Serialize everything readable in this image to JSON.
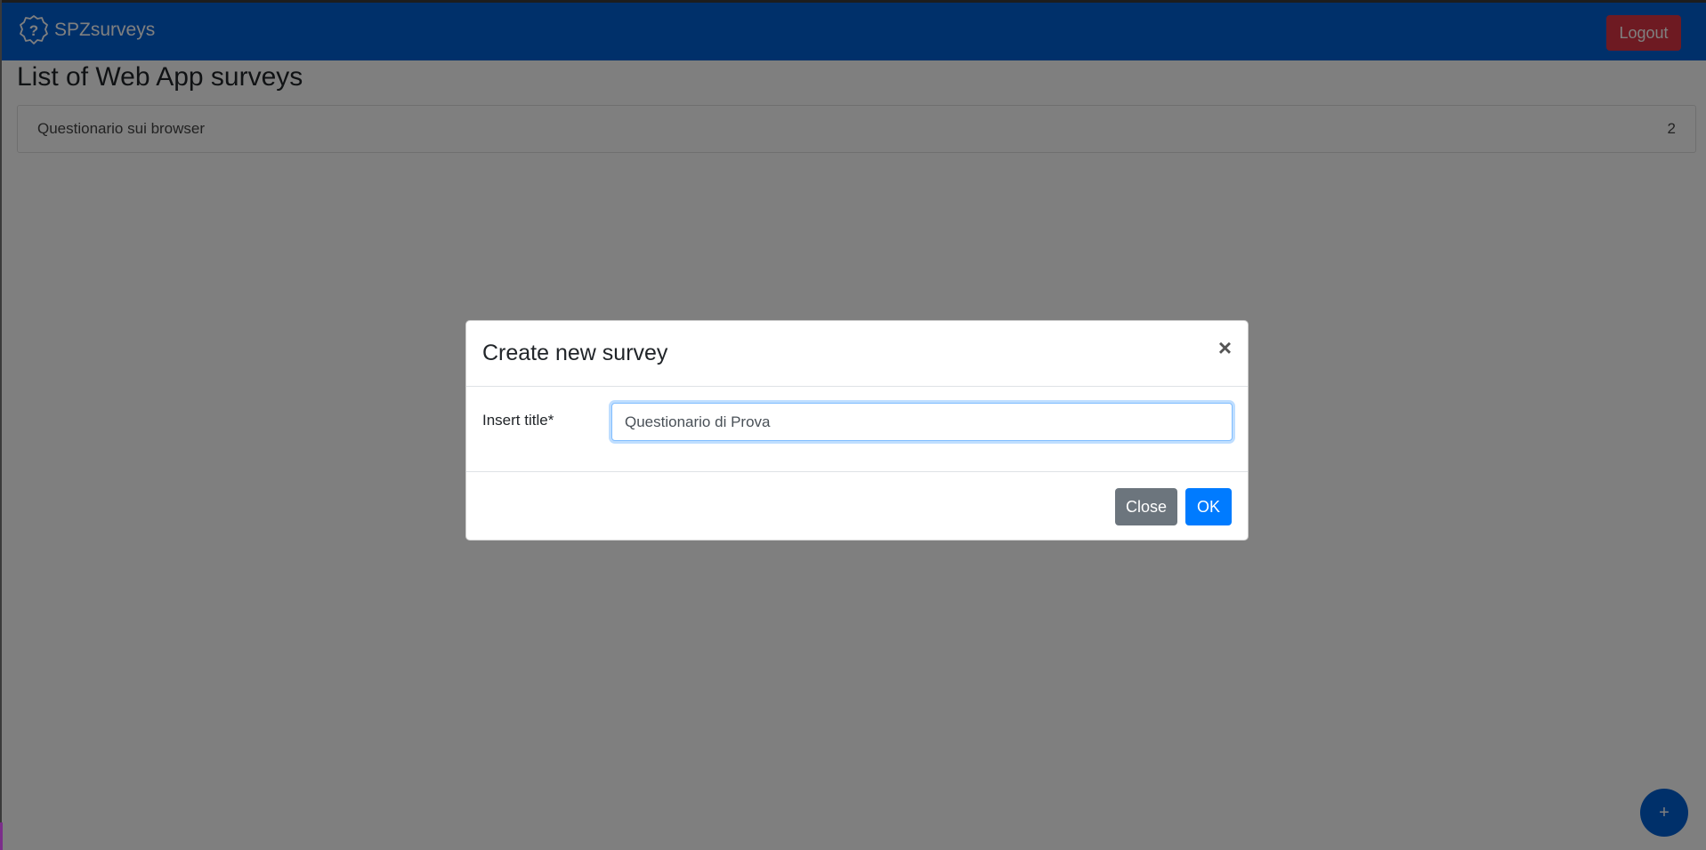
{
  "navbar": {
    "brand": "SPZsurveys",
    "brand_icon": "question-badge-icon",
    "logout_label": "Logout",
    "color": "#0160d5"
  },
  "main": {
    "title": "List of Web App surveys",
    "surveys": [
      {
        "name": "Questionario sui browser",
        "count": "2"
      }
    ],
    "fab_label": "+"
  },
  "modal": {
    "title": "Create new survey",
    "close_symbol": "×",
    "field_label": "Insert title*",
    "title_value": "Questionario di Prova",
    "close_button": "Close",
    "ok_button": "OK"
  },
  "colors": {
    "danger": "#dc3545",
    "primary": "#007bff",
    "secondary": "#6c757d"
  }
}
